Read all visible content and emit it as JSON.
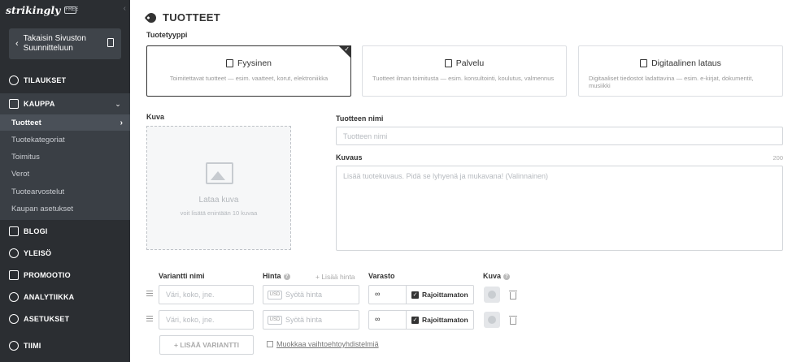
{
  "sidebar": {
    "logo": "strikingly",
    "logo_badge": "FREE",
    "collapse_icon": "‹",
    "back_button": {
      "line1": "Takaisin Sivuston",
      "line2": "Suunnitteluun"
    },
    "nav": {
      "tilaukset": "TILAUKSET",
      "kauppa": "KAUPPA",
      "blogi": "BLOGI",
      "yleiso": "YLEISÖ",
      "promootio": "PROMOOTIO",
      "analytiikka": "ANALYTIIKKA",
      "asetukset": "ASETUKSET",
      "tiimi": "TIIMI"
    },
    "kauppa_sub": [
      "Tuotteet",
      "Tuotekategoriat",
      "Toimitus",
      "Verot",
      "Tuotearvostelut",
      "Kaupan asetukset"
    ]
  },
  "main": {
    "title": "TUOTTEET",
    "type_label": "Tuotetyyppi",
    "types": [
      {
        "title": "Fyysinen",
        "desc": "Toimitettavat tuotteet — esim. vaatteet, korut, elektroniikka"
      },
      {
        "title": "Palvelu",
        "desc": "Tuotteet ilman toimitusta — esim. konsultointi, koulutus, valmennus"
      },
      {
        "title": "Digitaalinen lataus",
        "desc": "Digitaaliset tiedostot ladattavina — esim. e-kirjat, dokumentit, musiikki"
      }
    ],
    "image_label": "Kuva",
    "image_add": "Lataa kuva",
    "image_hint": "voit lisätä enintään 10 kuvaa",
    "name_label": "Tuotteen nimi",
    "name_placeholder": "Tuotteen nimi",
    "desc_label": "Kuvaus",
    "desc_counter": "200",
    "desc_placeholder": "Lisää tuotekuvaus. Pidä se lyhyenä ja mukavana! (Valinnainen)",
    "variants": {
      "name_col": "Variantti nimi",
      "price_col": "Hinta",
      "add_price": "+ Lisää hinta",
      "stock_col": "Varasto",
      "image_col": "Kuva",
      "name_placeholder": "Väri, koko, jne.",
      "currency": "USD",
      "price_placeholder": "Syötä hinta",
      "stock_value": "∞",
      "unlimited_label": "Rajoittamaton",
      "check": "✓",
      "add_variant": "+ LISÄÄ VARIANTTI",
      "edit_link": "Muokkaa vaihtoehtoyhdistelmiä"
    }
  }
}
